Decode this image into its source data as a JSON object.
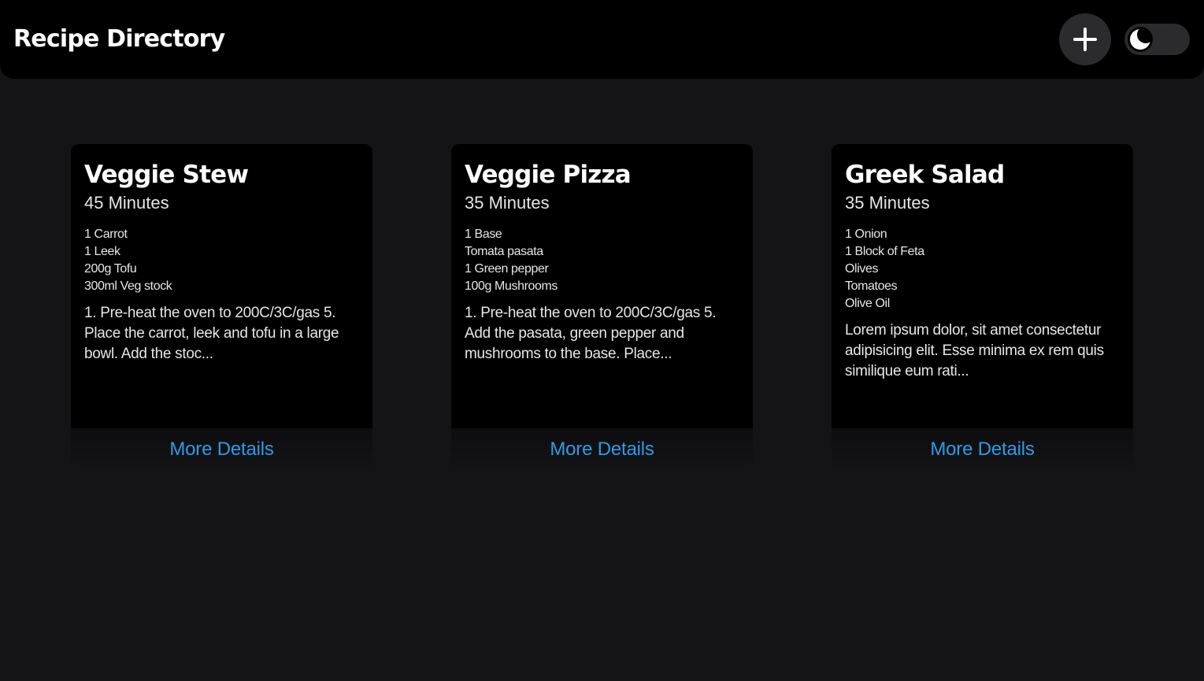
{
  "header": {
    "title": "Recipe Directory"
  },
  "controls": {
    "add_icon": "plus-icon",
    "theme_icon": "moon-icon"
  },
  "colors": {
    "background": "#141315",
    "header": "#000000",
    "card": "#000000",
    "link": "#2e9be6",
    "button": "#2b2a2d"
  },
  "recipes": [
    {
      "title": "Veggie Stew",
      "time": "45 Minutes",
      "ingredients": [
        "1 Carrot",
        "1 Leek",
        "200g Tofu",
        "300ml Veg stock"
      ],
      "method": "1. Pre-heat the oven to 200C/3C/gas 5. Place the carrot, leek and tofu in a large bowl. Add the stoc...",
      "link": "More Details"
    },
    {
      "title": "Veggie Pizza",
      "time": "35 Minutes",
      "ingredients": [
        "1 Base",
        "Tomata pasata",
        "1 Green pepper",
        "100g Mushrooms"
      ],
      "method": "1. Pre-heat the oven to 200C/3C/gas 5. Add the pasata, green pepper and mushrooms to the base. Place...",
      "link": "More Details"
    },
    {
      "title": "Greek Salad",
      "time": "35 Minutes",
      "ingredients": [
        "1 Onion",
        "1 Block of Feta",
        "Olives",
        "Tomatoes",
        "Olive Oil"
      ],
      "method": "Lorem ipsum dolor, sit amet consectetur adipisicing elit. Esse minima ex rem quis similique eum rati...",
      "link": "More Details"
    }
  ]
}
